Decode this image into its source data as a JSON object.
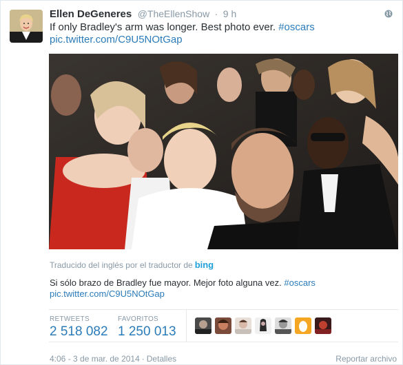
{
  "tweet": {
    "author_name": "Ellen DeGeneres",
    "author_handle": "@TheEllenShow",
    "separator": "·",
    "time": "9 h",
    "text_main": "If only Bradley's arm was longer. Best photo ever.",
    "hashtag": "#oscars",
    "pic_link": "pic.twitter.com/C9U5NOtGap"
  },
  "translation": {
    "label": "Traducido del inglés por el traductor de",
    "provider": "bing",
    "text_main": "Si sólo brazo de Bradley fue mayor. Mejor foto alguna vez.",
    "hashtag": "#oscars",
    "pic_link": "pic.twitter.com/C9U5NOtGap"
  },
  "stats": {
    "retweets_label": "RETWEETS",
    "retweets_value": "2 518 082",
    "favorites_label": "FAVORITOS",
    "favorites_value": "1 250 013"
  },
  "footer": {
    "timestamp": "4:06 - 3 de mar. de 2014",
    "separator": "·",
    "details": "Detalles",
    "report": "Reportar archivo"
  },
  "colors": {
    "link": "#2b7bb9",
    "muted": "#8899a6",
    "text": "#292f33"
  }
}
